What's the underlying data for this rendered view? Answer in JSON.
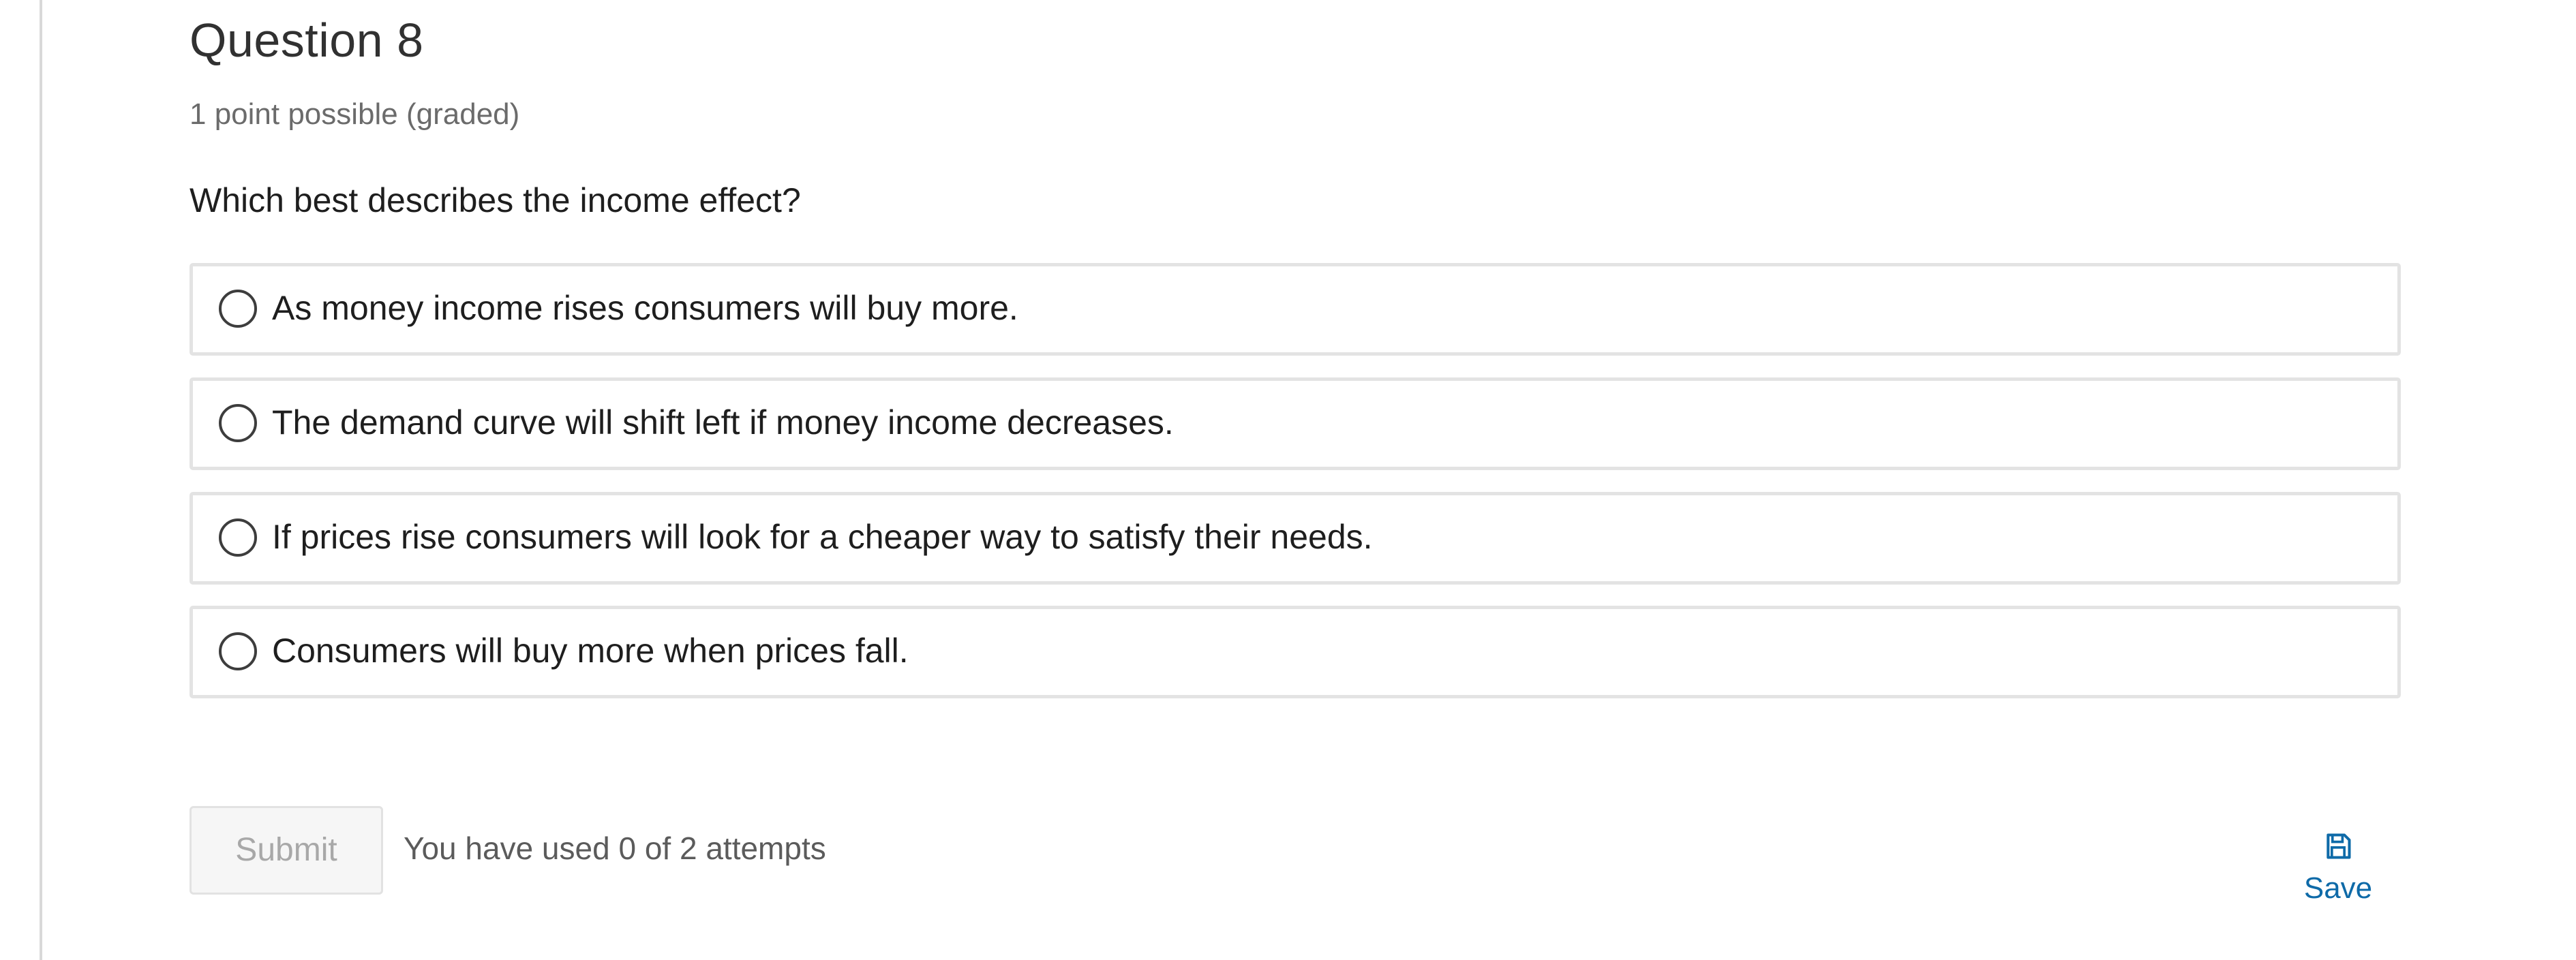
{
  "question": {
    "title": "Question 8",
    "points": "1 point possible (graded)",
    "prompt": "Which best describes the income effect?"
  },
  "options": [
    {
      "label": "As money income rises consumers will buy more.",
      "selected": false
    },
    {
      "label": "The demand curve will shift left if money income decreases.",
      "selected": false
    },
    {
      "label": "If prices rise consumers will look for a cheaper way to satisfy their needs.",
      "selected": false
    },
    {
      "label": "Consumers will buy more when prices fall.",
      "selected": false
    }
  ],
  "actions": {
    "submit_label": "Submit",
    "submit_enabled": false,
    "attempts_text": "You have used 0 of 2 attempts",
    "save_label": "Save",
    "save_icon": "floppy-disk-icon"
  },
  "colors": {
    "link_accent": "#0e6aa8",
    "border": "#e3e3e3",
    "disabled_text": "#a8a8a8"
  }
}
